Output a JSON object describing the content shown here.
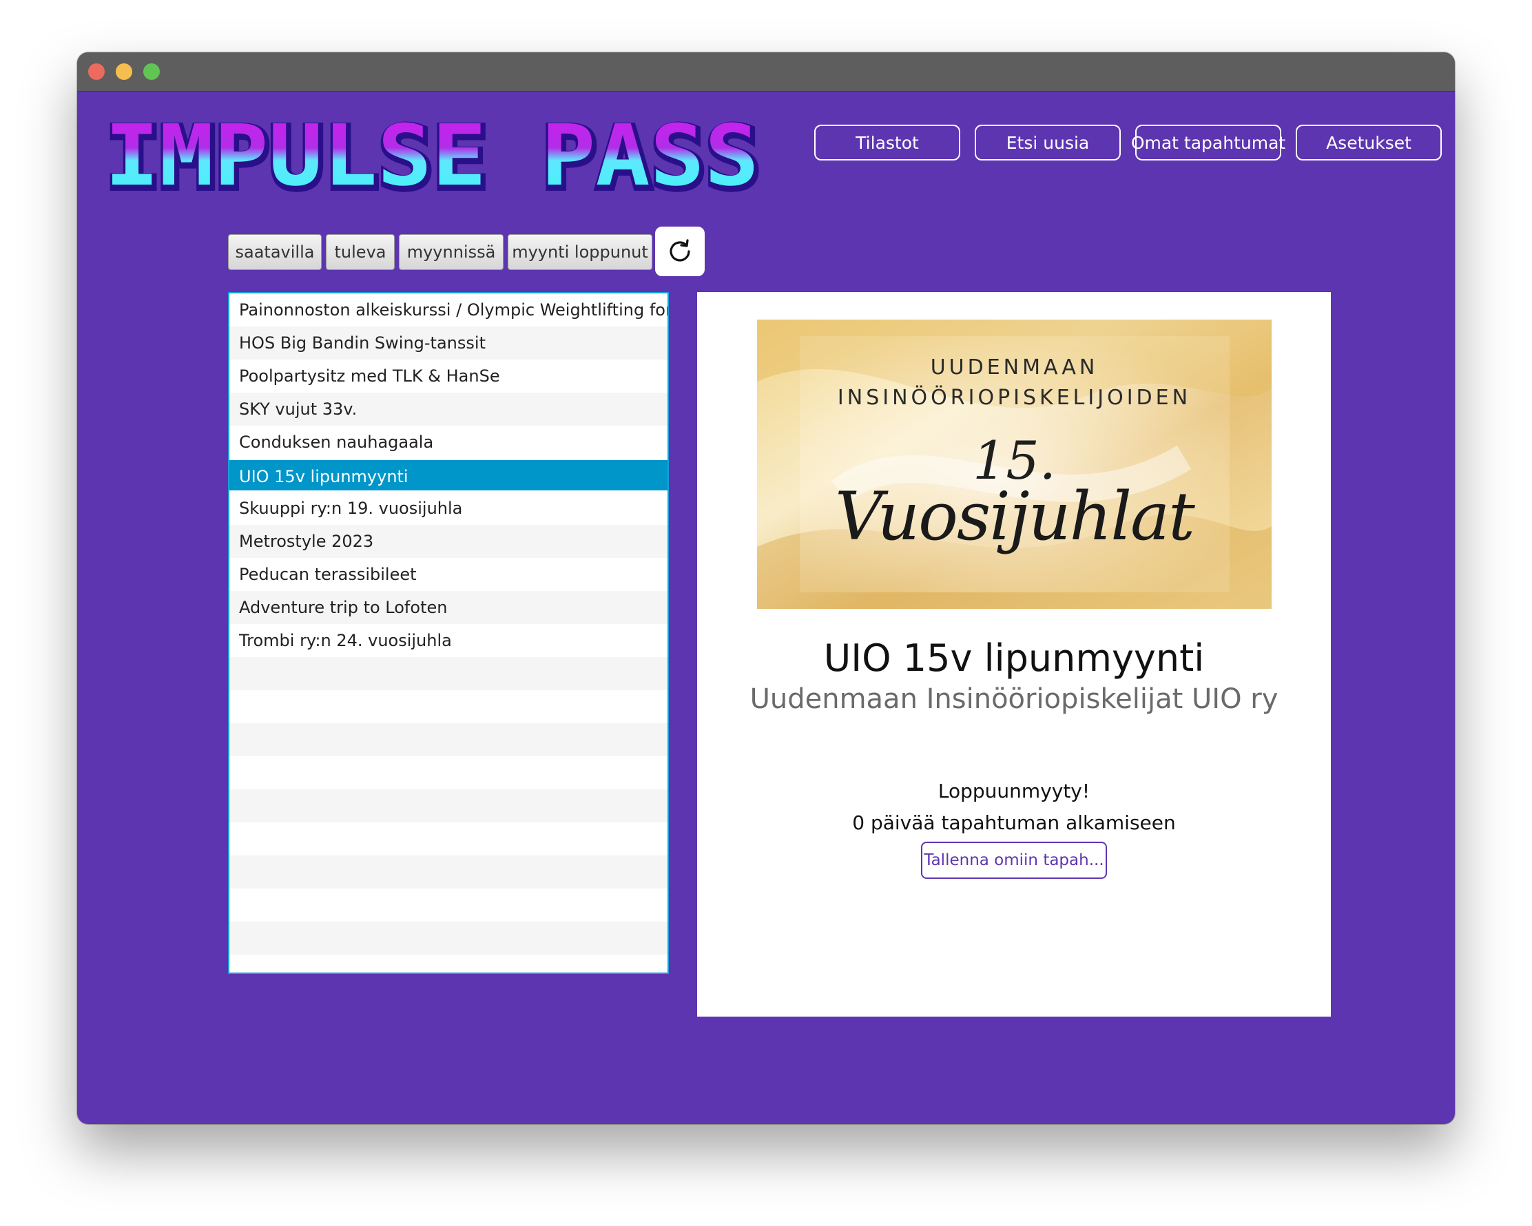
{
  "window": {
    "traffic_lights": [
      "close",
      "minimize",
      "maximize"
    ]
  },
  "app": {
    "logo_text": "IMPULSE PASS",
    "colors": {
      "background": "#5d35b0",
      "logo_top": "#d21cf0",
      "logo_bottom": "#4ef2ff",
      "selection": "#0096c9"
    }
  },
  "nav": {
    "stats": "Tilastot",
    "search": "Etsi uusia",
    "my_events": "Omat tapahtumat",
    "settings": "Asetukset"
  },
  "filters": {
    "available": "saatavilla",
    "upcoming": "tuleva",
    "on_sale": "myynnissä",
    "sale_ended": "myynti loppunut",
    "refresh_icon": "refresh-icon"
  },
  "events": [
    "Painonnoston alkeiskurssi / Olympic Weightlifting for beginners",
    "HOS Big Bandin Swing-tanssit",
    "Poolpartysitz med TLK & HanSe",
    "SKY vujut 33v.",
    "Conduksen nauhagaala",
    "UIO 15v lipunmyynti",
    "Skuuppi ry:n 19. vuosijuhla",
    "Metrostyle 2023",
    "Peducan terassibileet",
    "Adventure trip to Lofoten",
    "Trombi ry:n 24. vuosijuhla"
  ],
  "selected_index": 5,
  "detail": {
    "poster": {
      "line1": "UUDENMAAN",
      "line2": "INSINÖÖRIOPISKELIJOIDEN",
      "number": "15.",
      "script": "Vuosijuhlat"
    },
    "title": "UIO 15v lipunmyynti",
    "organizer": "Uudenmaan Insinööriopiskelijat UIO ry",
    "status": "Loppuunmyyty!",
    "days_until": "0 päivää tapahtuman alkamiseen",
    "save_button": "Tallenna omiin tapah..."
  }
}
